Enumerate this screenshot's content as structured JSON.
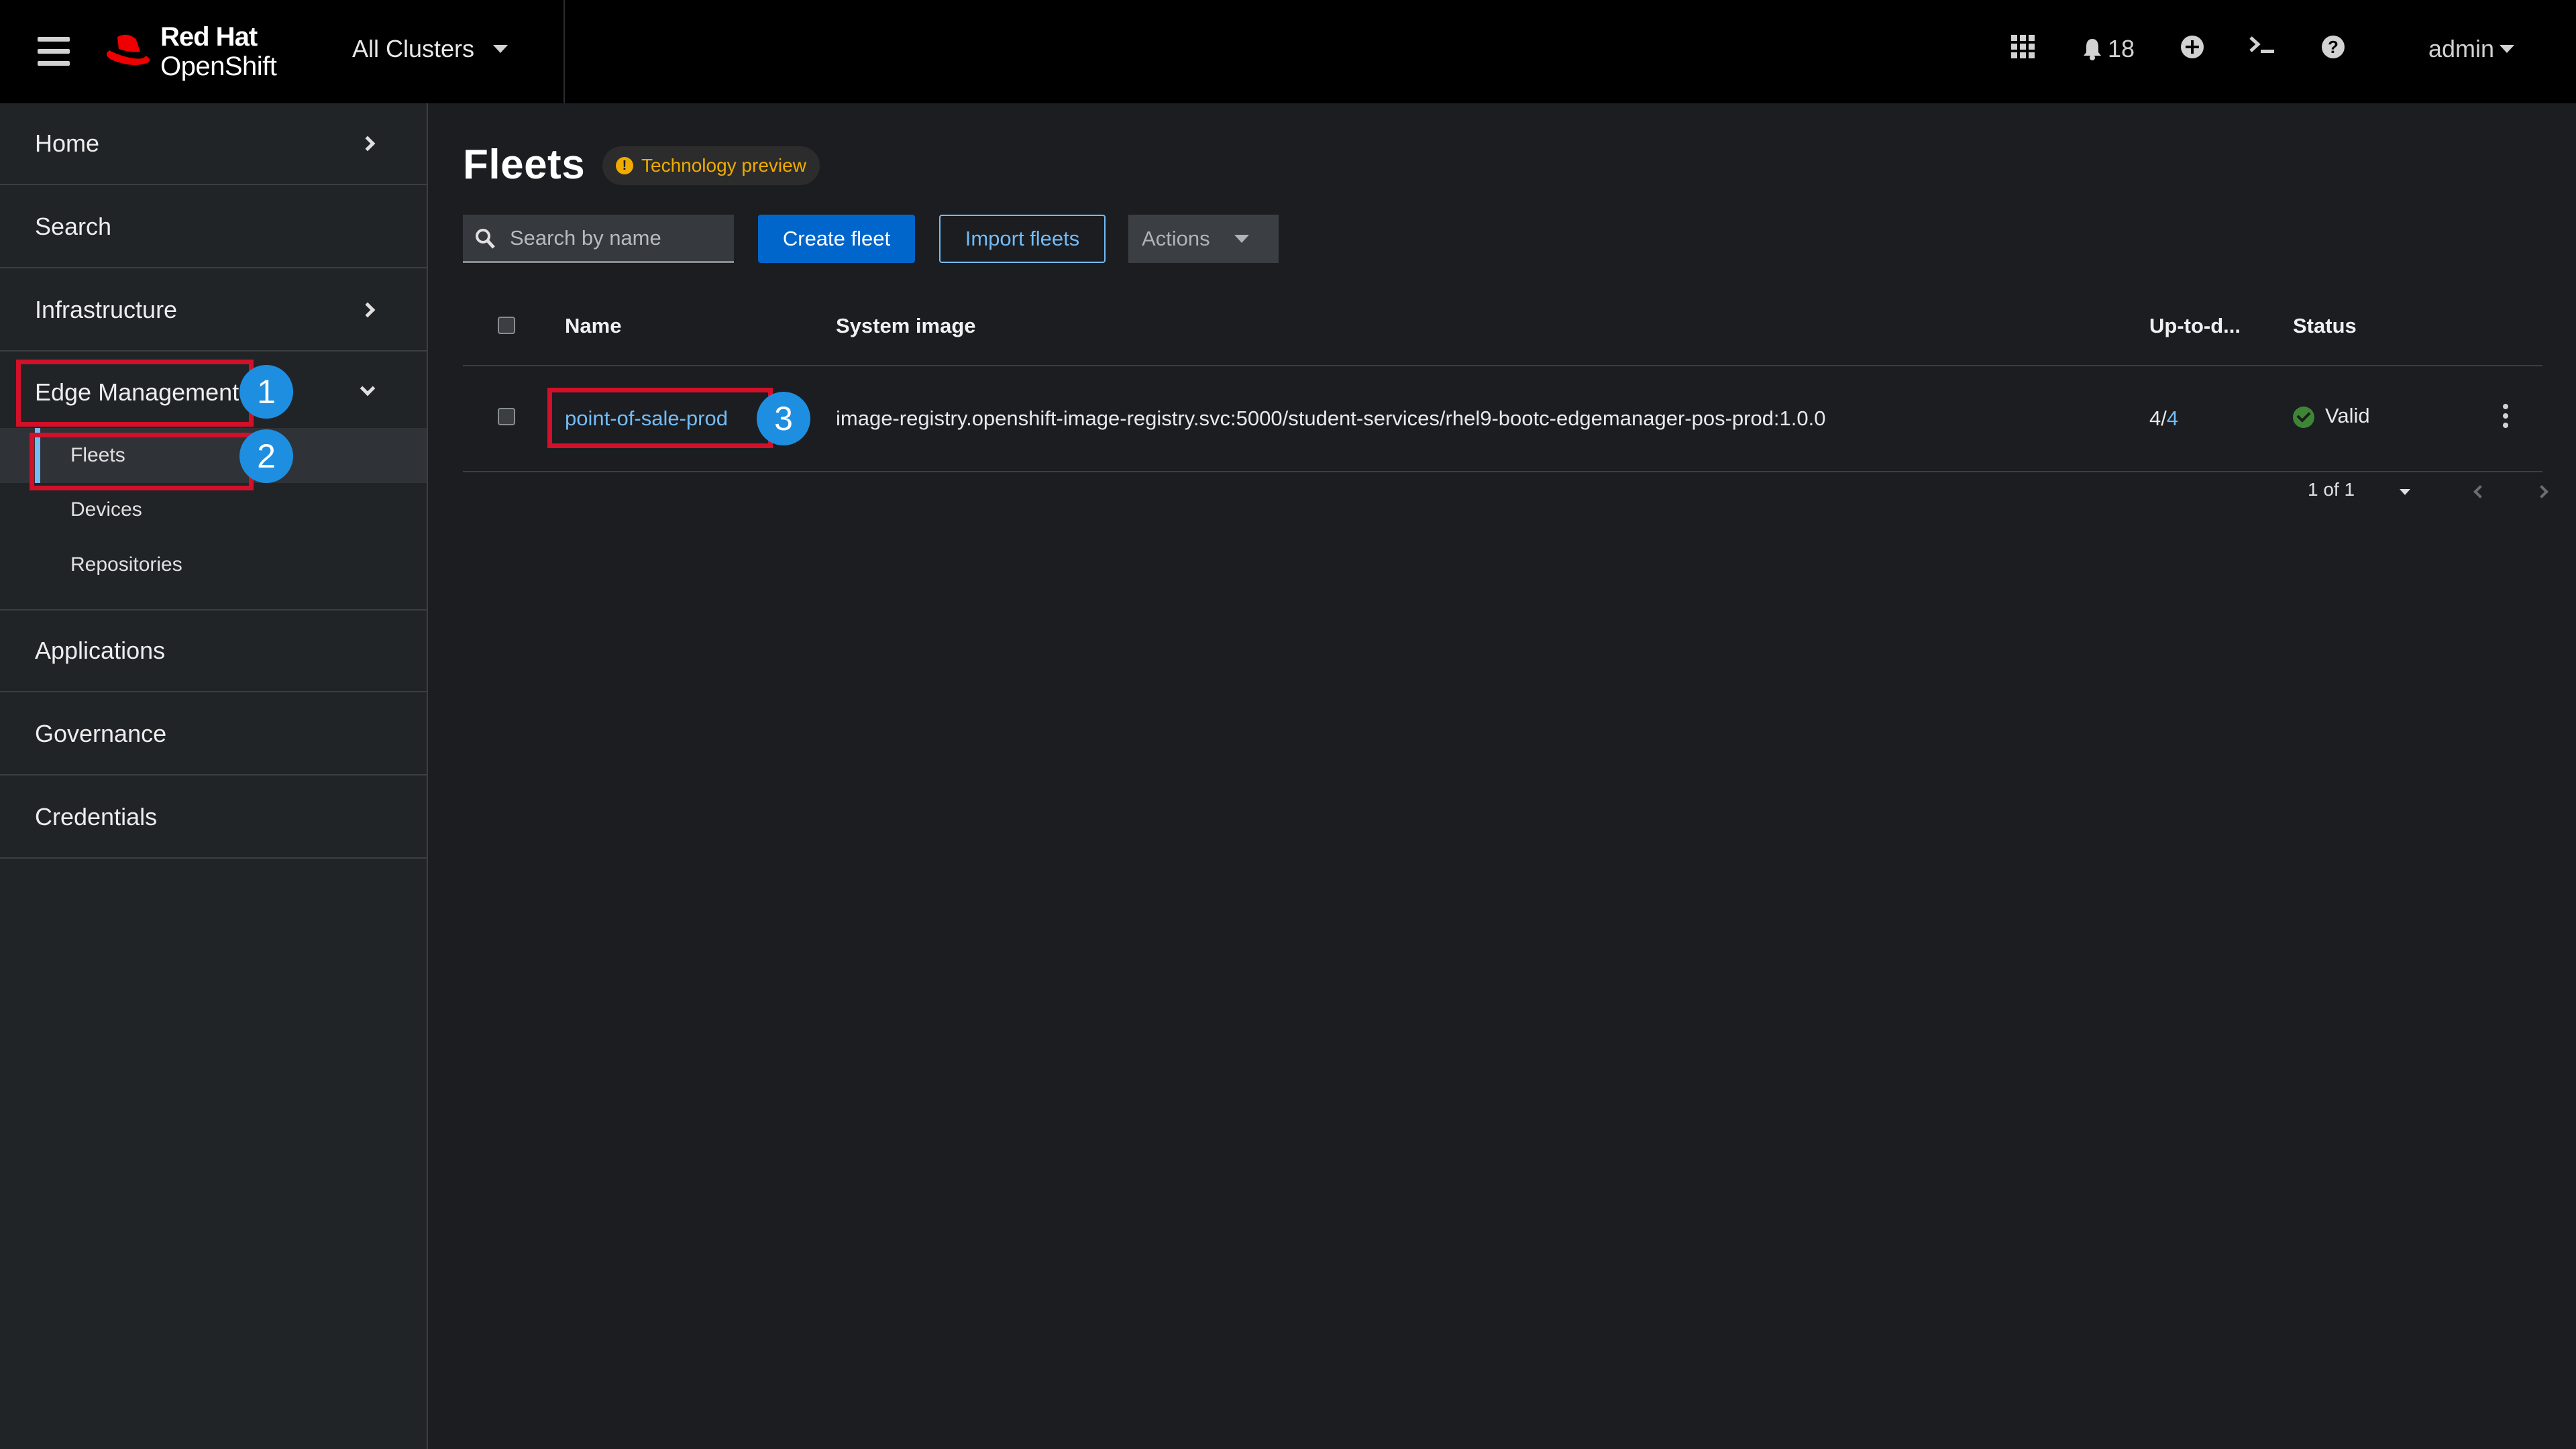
{
  "masthead": {
    "brand_line1": "Red Hat",
    "brand_line2": "OpenShift",
    "cluster_selector": "All Clusters",
    "notifications_count": "18",
    "user": "admin",
    "icons": [
      "menu-icon",
      "app-launcher-icon",
      "bell-icon",
      "add-icon",
      "terminal-icon",
      "help-icon"
    ]
  },
  "sidebar": {
    "items": [
      {
        "label": "Home"
      },
      {
        "label": "Search"
      },
      {
        "label": "Infrastructure"
      },
      {
        "label": "Edge Management"
      },
      {
        "label": "Applications"
      },
      {
        "label": "Governance"
      },
      {
        "label": "Credentials"
      }
    ],
    "edge_sub_items": [
      {
        "label": "Fleets"
      },
      {
        "label": "Devices"
      },
      {
        "label": "Repositories"
      }
    ]
  },
  "annotations": [
    "1",
    "2",
    "3"
  ],
  "main": {
    "title": "Fleets",
    "tech_label": "Technology preview",
    "search_placeholder": "Search by name",
    "create_button": "Create fleet",
    "import_button": "Import fleets",
    "actions_button": "Actions",
    "columns": [
      "Name",
      "System image",
      "Up-to-d...",
      "Status"
    ],
    "rows": [
      {
        "name": "point-of-sale-prod",
        "system_image": "image-registry.openshift-image-registry.svc:5000/student-services/rhel9-bootc-edgemanager-pos-prod:1.0.0",
        "up_to_date_a": "4/",
        "up_to_date_b": "4",
        "status": "Valid"
      }
    ],
    "pagination": "1 of 1"
  },
  "colors": {
    "masthead_bg": "#000000",
    "sidebar_bg": "#212427",
    "page_bg": "#1b1d21",
    "primary": "#0066cc",
    "link": "#73bcf7",
    "annotation_red": "#d2102a",
    "annotation_badge": "#1e8fe0",
    "success": "#3e8635",
    "warning": "#f0ab00"
  }
}
